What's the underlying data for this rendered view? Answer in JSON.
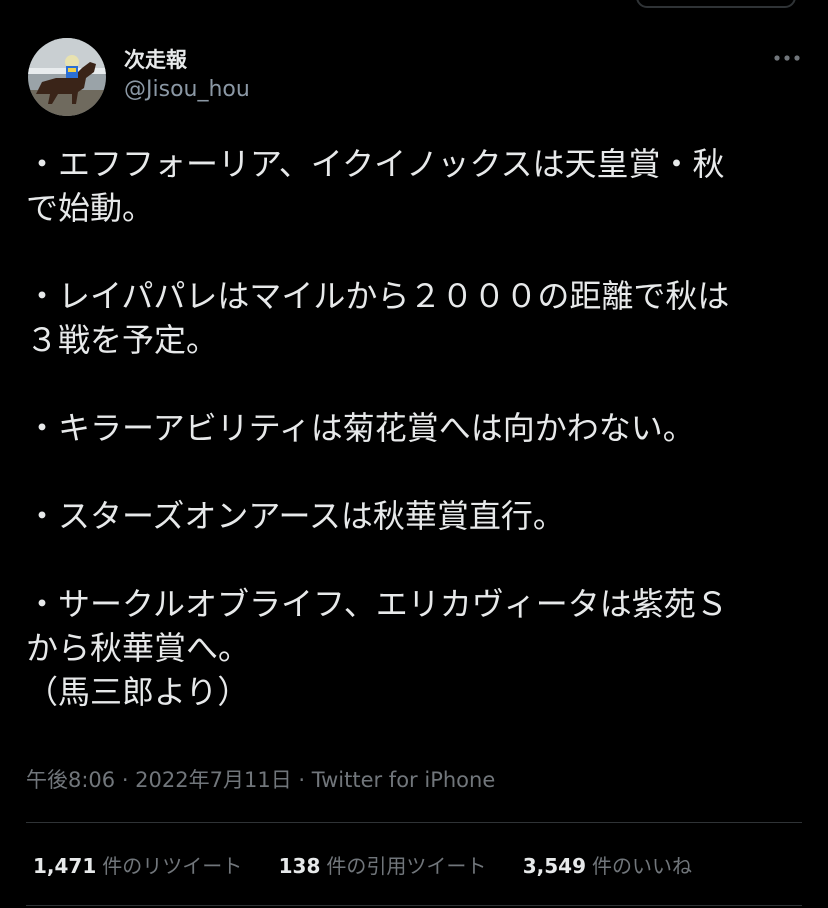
{
  "tweet": {
    "author": {
      "display_name": "次走報",
      "handle": "@Jisou_hou",
      "avatar_icon": "horse-racing-avatar"
    },
    "more_icon": "more-dots-icon",
    "lines": [
      "・エフフォーリア、イクイノックスは天皇賞・秋",
      "で始動。",
      "",
      "・レイパパレはマイルから２０００の距離で秋は",
      "３戦を予定。",
      "",
      "・キラーアビリティは菊花賞へは向かわない。",
      "",
      "・スターズオンアースは秋華賞直行。",
      "",
      "・サークルオブライフ、エリカヴィータは紫苑Ｓ",
      "から秋華賞へ。",
      "（馬三郎より）"
    ],
    "timestamp": "午後8:06 · 2022年7月11日 · ",
    "source": "Twitter for iPhone"
  },
  "stats": {
    "retweets": {
      "count": "1,471",
      "label": "件のリツイート"
    },
    "quotes": {
      "count": "138",
      "label": "件の引用ツイート"
    },
    "likes": {
      "count": "3,549",
      "label": "件のいいね"
    }
  },
  "colors": {
    "background": "#000000",
    "text": "#e7e9ea",
    "secondary": "#71767b",
    "divider": "#2f3336"
  }
}
